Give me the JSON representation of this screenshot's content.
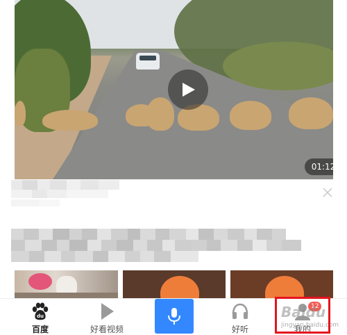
{
  "video": {
    "duration": "01:12",
    "play_icon": "play-icon"
  },
  "feed_card": {
    "title_obscured": true,
    "close_icon": "close-icon"
  },
  "tabbar": {
    "tabs": [
      {
        "id": "home",
        "label": "百度",
        "icon": "baidu-paw-icon",
        "active": true
      },
      {
        "id": "haokan",
        "label": "好看视频",
        "icon": "play-triangle-icon",
        "active": false
      },
      {
        "id": "voice",
        "label": "",
        "icon": "microphone-icon",
        "active": false
      },
      {
        "id": "listen",
        "label": "好听",
        "icon": "headphones-icon",
        "active": false
      },
      {
        "id": "mine",
        "label": "我的",
        "icon": "avatar-icon",
        "active": false
      }
    ],
    "badge_count": "12"
  },
  "watermark": {
    "text": "Baidu",
    "sub": "jingyan.baidu.com"
  },
  "colors": {
    "accent": "#3388ff",
    "highlight": "#e5141e",
    "badge": "#f25c54"
  }
}
